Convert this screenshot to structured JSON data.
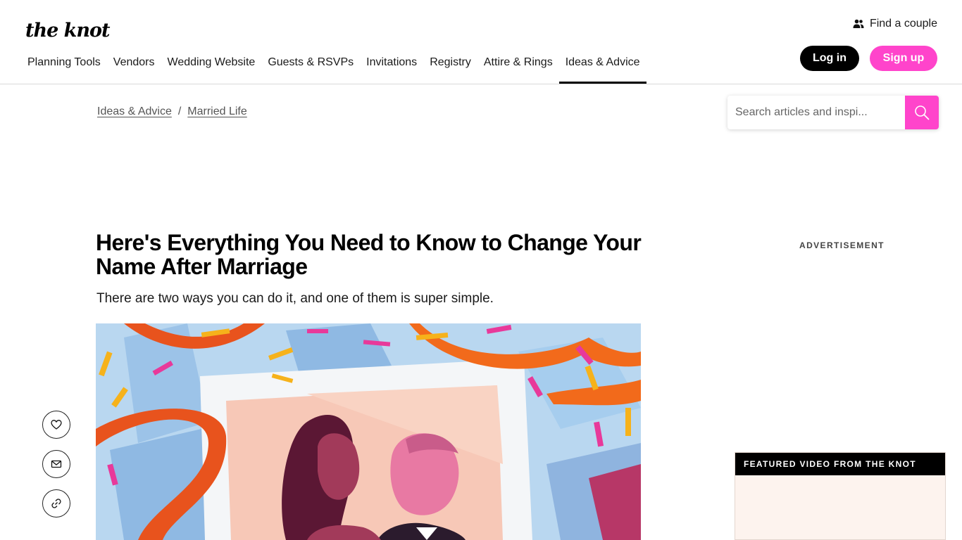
{
  "header": {
    "logo": "the knot",
    "find_couple": "Find a couple",
    "login": "Log in",
    "signup": "Sign up",
    "nav": [
      {
        "label": "Planning Tools"
      },
      {
        "label": "Vendors"
      },
      {
        "label": "Wedding Website"
      },
      {
        "label": "Guests & RSVPs"
      },
      {
        "label": "Invitations"
      },
      {
        "label": "Registry"
      },
      {
        "label": "Attire & Rings"
      },
      {
        "label": "Ideas & Advice",
        "active": true
      }
    ]
  },
  "breadcrumb": {
    "items": [
      "Ideas & Advice",
      "Married Life"
    ],
    "separator": "/"
  },
  "search": {
    "placeholder": "Search articles and inspi..."
  },
  "article": {
    "title": "Here's Everything You Need to Know to Change Your Name After Marriage",
    "subtitle": "There are two ways you can do it, and one of them is super simple."
  },
  "sidebar": {
    "ad_label": "ADVERTISEMENT",
    "featured_video_label": "FEATURED VIDEO FROM THE KNOT"
  },
  "share_icons": [
    "heart-icon",
    "mail-icon",
    "link-icon"
  ],
  "colors": {
    "brand_pink": "#ff44cb",
    "black": "#000000"
  }
}
